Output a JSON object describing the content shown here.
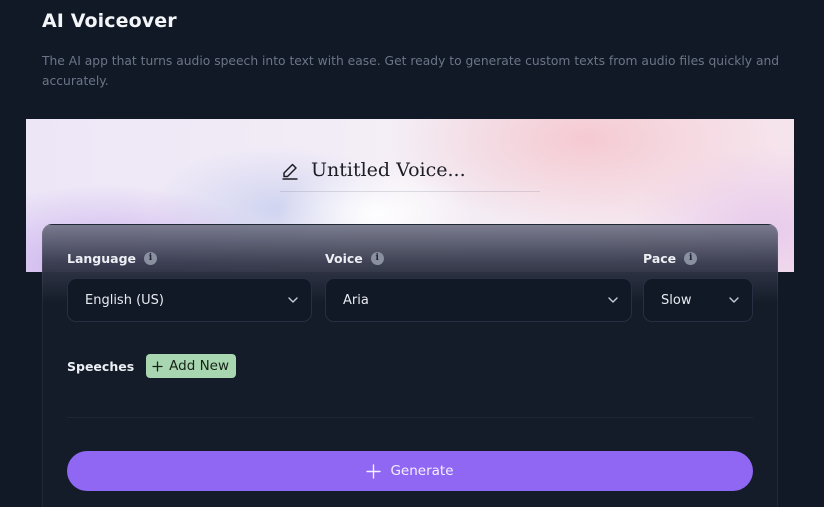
{
  "header": {
    "title": "AI Voiceover",
    "subtitle": "The AI app that turns audio speech into text with ease. Get ready to generate custom texts from audio files quickly and accurately."
  },
  "banner": {
    "voice_name": "Untitled Voice...",
    "icon": "pencil-icon"
  },
  "settings": {
    "language": {
      "label": "Language",
      "value": "English (US)"
    },
    "voice": {
      "label": "Voice",
      "value": "Aria"
    },
    "pace": {
      "label": "Pace",
      "value": "Slow"
    },
    "info_icon": "i"
  },
  "speeches": {
    "label": "Speeches",
    "add_label": "Add New"
  },
  "actions": {
    "generate_label": "Generate"
  },
  "colors": {
    "background": "#111926",
    "accent": "#9067f2",
    "add_button": "#a8d6b0"
  }
}
